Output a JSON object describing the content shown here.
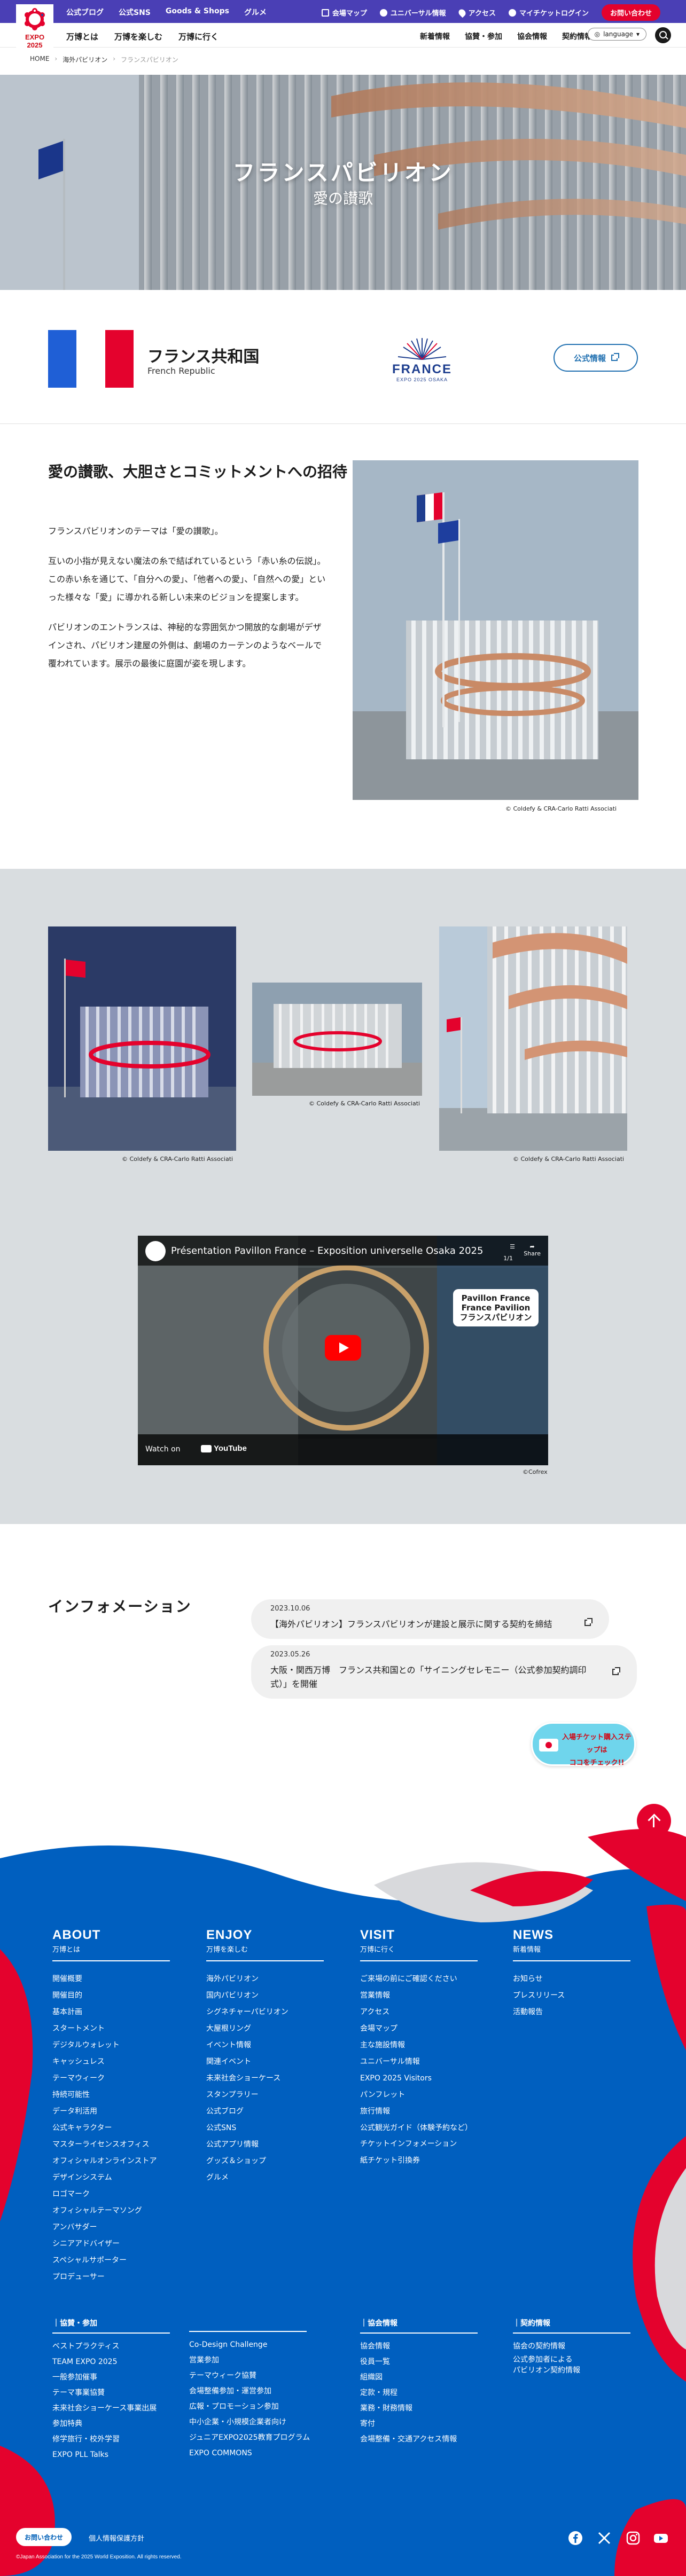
{
  "header": {
    "logo_text": "EXPO\n2025",
    "top_nav": [
      "公式ブログ",
      "公式SNS",
      "Goods & Shops",
      "グルメ"
    ],
    "top_util": [
      "会場マップ",
      "ユニバーサル情報",
      "アクセス",
      "マイチケットログイン"
    ],
    "contact_label": "お問い合わせ",
    "main_nav": [
      "万博とは",
      "万博を楽しむ",
      "万博に行く"
    ],
    "sub_nav": [
      "新着情報",
      "協賛・参加",
      "協会情報",
      "契約情報"
    ],
    "language_label": "language"
  },
  "breadcrumb": [
    "HOME",
    "海外パビリオン",
    "フランスパビリオン"
  ],
  "hero": {
    "title": "フランスパビリオン",
    "subtitle": "愛の讃歌"
  },
  "country": {
    "name_ja": "フランス共和国",
    "name_en": "French Republic",
    "flag_colors": [
      "#1f5fd6",
      "#ffffff",
      "#e4022d"
    ],
    "logo_word": "FRANCE",
    "logo_sub": "EXPO 2025 OSAKA",
    "official_label": "公式情報"
  },
  "concept": {
    "title": "愛の讃歌、大胆さとコミットメントへの招待",
    "paragraphs": [
      "フランスパビリオンのテーマは「愛の讃歌」。",
      "互いの小指が見えない魔法の糸で結ばれているという「赤い糸の伝説」。この赤い糸を通じて、「自分への愛」、「他者への愛」、「自然への愛」といった様々な「愛」に導かれる新しい未来のビジョンを提案します。",
      "パビリオンのエントランスは、神秘的な雰囲気かつ開放的な劇場がデザインされ、パビリオン建屋の外側は、劇場のカーテンのようなベールで覆われています。展示の最後に庭園が姿を現します。"
    ],
    "image_caption": "© Coldefy & CRA-Carlo Ratti Associati"
  },
  "gallery": {
    "captions": [
      "© Coldefy & CRA-Carlo Ratti Associati",
      "© Coldefy & CRA-Carlo Ratti Associati",
      "© Coldefy & CRA-Carlo Ratti Associati"
    ],
    "video": {
      "title": "Présentation Pavillon France – Exposition universelle Osaka 2025",
      "count": "1/1",
      "share_label": "Share",
      "overlay_label": "Pavillon France\nFrance Pavilion\nフランスパビリオン",
      "watch_on": "Watch on",
      "youtube_word": "YouTube",
      "caption": "©Cofrex"
    }
  },
  "information": {
    "title": "インフォメーション",
    "items": [
      {
        "date": "2023.10.06",
        "text": "【海外パビリオン】フランスパビリオンが建設と展示に関する契約を締結"
      },
      {
        "date": "2023.05.26",
        "text": "大阪・関西万博　フランス共和国との「サイニングセレモニー（公式参加契約調印式）」を開催"
      }
    ],
    "ticket_banner": "入場チケット購入ステップは\nココをチェック!!"
  },
  "footer": {
    "columns": [
      {
        "head": "ABOUT",
        "sub": "万博とは",
        "items": [
          "開催概要",
          "開催目的",
          "基本計画",
          "スタートメント",
          "デジタルウォレット",
          "キャッシュレス",
          "テーマウィーク",
          "持続可能性",
          "データ利活用",
          "公式キャラクター",
          "マスターライセンスオフィス",
          "オフィシャルオンラインストア",
          "デザインシステム",
          "ロゴマーク",
          "オフィシャルテーマソング",
          "アンバサダー",
          "シニアアドバイザー",
          "スペシャルサポーター",
          "プロデューサー"
        ]
      },
      {
        "head": "ENJOY",
        "sub": "万博を楽しむ",
        "items": [
          "海外パビリオン",
          "国内パビリオン",
          "シグネチャーパビリオン",
          "大屋根リング",
          "イベント情報",
          "関連イベント",
          "未来社会ショーケース",
          "スタンプラリー",
          "公式ブログ",
          "公式SNS",
          "公式アプリ情報",
          "グッズ＆ショップ",
          "グルメ"
        ]
      },
      {
        "head": "VISIT",
        "sub": "万博に行く",
        "items": [
          "ご来場の前にご確認ください",
          "営業情報",
          "アクセス",
          "会場マップ",
          "主な施設情報",
          "ユニバーサル情報",
          "EXPO 2025 Visitors",
          "パンフレット",
          "旅行情報",
          "公式観光ガイド（体験予約など）",
          "チケットインフォメーション",
          "紙チケット引換券"
        ]
      },
      {
        "head": "NEWS",
        "sub": "新着情報",
        "items": [
          "お知らせ",
          "プレスリリース",
          "活動報告"
        ]
      }
    ],
    "sub_columns": [
      {
        "head": "協賛・参加",
        "items": [
          "ベストプラクティス",
          "TEAM EXPO 2025",
          "一般参加催事",
          "テーマ事業協賛",
          "未来社会ショーケース事業出展",
          "参加特典",
          "修学旅行・校外学習",
          "EXPO PLL Talks"
        ]
      },
      {
        "head": "",
        "items": [
          "Co-Design Challenge",
          "営業参加",
          "テーマウィーク協賛",
          "会場整備参加・運営参加",
          "広報・プロモーション参加",
          "中小企業・小規模企業者向け",
          "ジュニアEXPO2025教育プログラム",
          "EXPO COMMONS"
        ]
      },
      {
        "head": "協会情報",
        "items": [
          "協会情報",
          "役員一覧",
          "組織図",
          "定款・規程",
          "業務・財務情報",
          "寄付",
          "会場整備・交通アクセス情報"
        ]
      },
      {
        "head": "契約情報",
        "items": [
          "協会の契約情報",
          "公式参加者による\nパビリオン契約情報"
        ]
      }
    ],
    "contact_label": "お問い合わせ",
    "privacy_label": "個人情報保護方針",
    "copyright": "©Japan Association for the 2025 World Exposition. All rights reserved.",
    "social": [
      "facebook-icon",
      "x-icon",
      "instagram-icon",
      "youtube-icon"
    ]
  }
}
